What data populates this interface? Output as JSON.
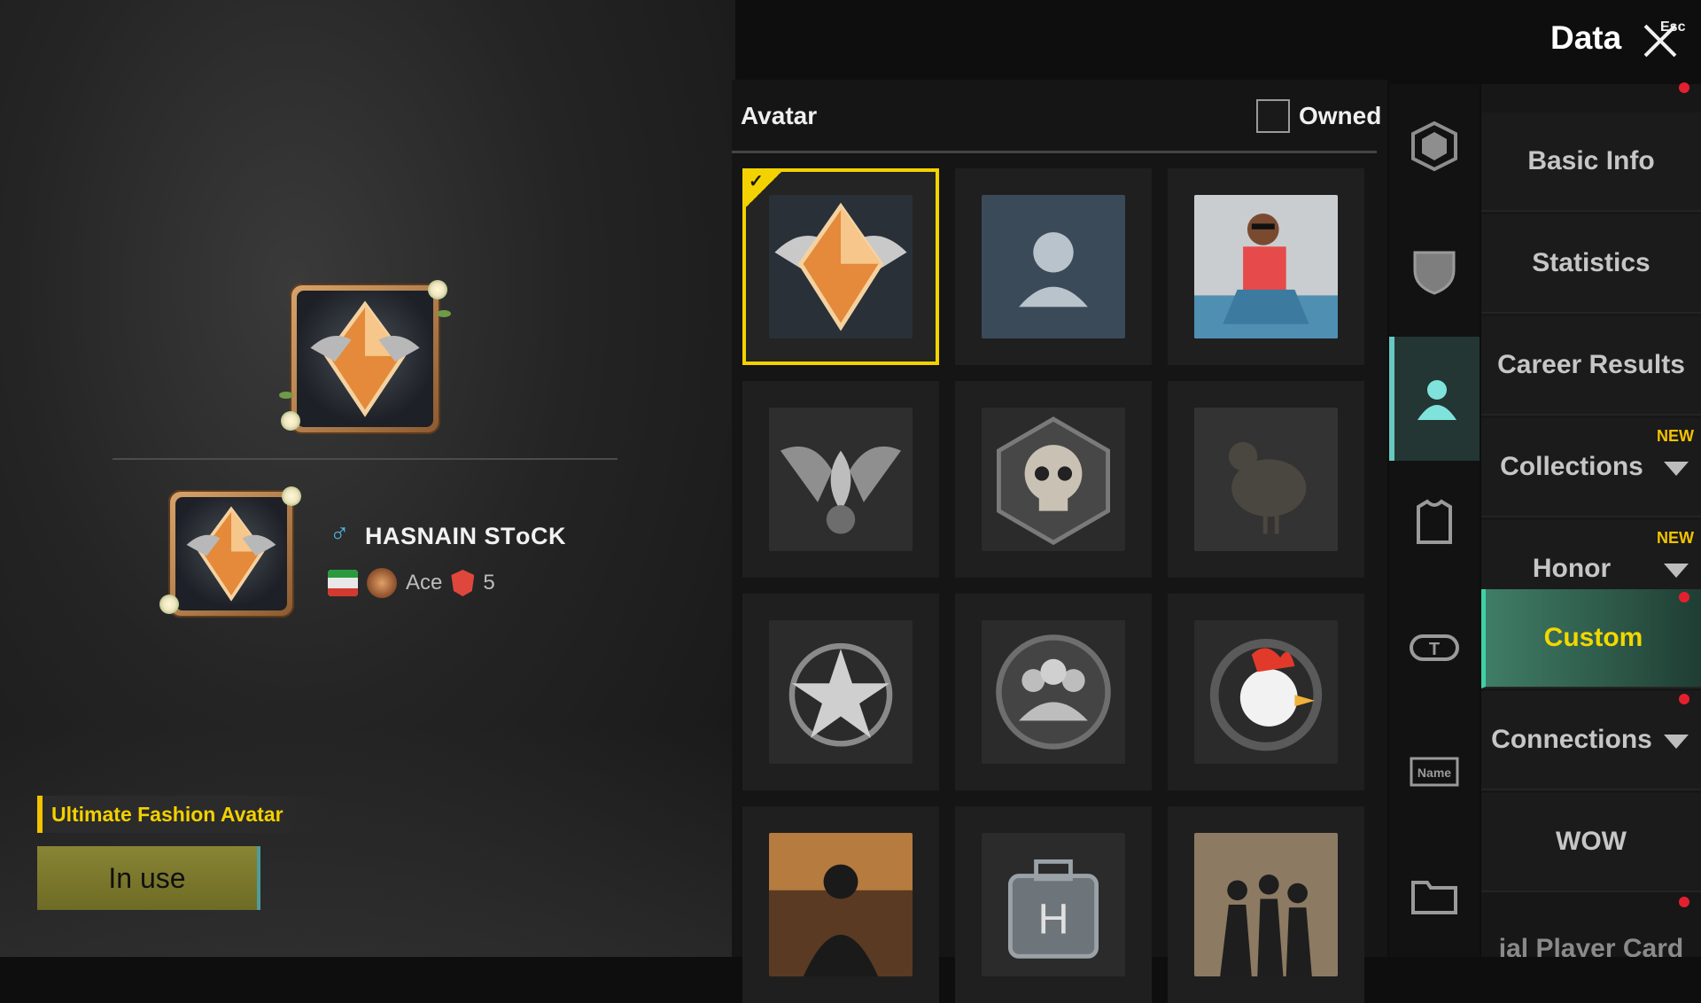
{
  "header": {
    "title": "Data",
    "esc_label": "Esc"
  },
  "profile": {
    "player_name": "HASNAIN STᴏCK",
    "gender_symbol": "♂",
    "rank_label": "Ace",
    "rank_level": "5",
    "fashion_tag": "Ultimate Fashion Avatar",
    "in_use_label": "In use"
  },
  "avatar_panel": {
    "title": "Avatar",
    "owned_label": "Owned",
    "items": [
      {
        "name": "ace-emblem-avatar",
        "selected": true
      },
      {
        "name": "default-silhouette-avatar"
      },
      {
        "name": "photo-avatar"
      },
      {
        "name": "winged-flame-avatar"
      },
      {
        "name": "skull-hexagon-avatar"
      },
      {
        "name": "chicken-avatar"
      },
      {
        "name": "star-medal-avatar"
      },
      {
        "name": "squad-avatar"
      },
      {
        "name": "rooster-avatar"
      },
      {
        "name": "soldier-avatar"
      },
      {
        "name": "medkit-avatar"
      },
      {
        "name": "squad-silhouette-avatar"
      }
    ]
  },
  "icon_tabs": [
    "frame-icon",
    "shield-icon",
    "avatar-icon",
    "outfit-icon",
    "title-tag-icon",
    "name-tag-icon",
    "card-folder-icon"
  ],
  "menu": {
    "items": [
      {
        "label": "Basic Info"
      },
      {
        "label": "Statistics"
      },
      {
        "label": "Career Results"
      },
      {
        "label": "Collections",
        "badge": "NEW",
        "caret": true
      },
      {
        "label": "Honor",
        "badge": "NEW",
        "caret": true
      },
      {
        "label": "Custom",
        "active": true
      },
      {
        "label": "Connections",
        "caret": true
      },
      {
        "label": "WOW"
      }
    ],
    "cut_label": "ial Player Card"
  },
  "colors": {
    "accent_yellow": "#f3d200",
    "active_teal": "#3f7d66",
    "notification_red": "#e5202e"
  }
}
